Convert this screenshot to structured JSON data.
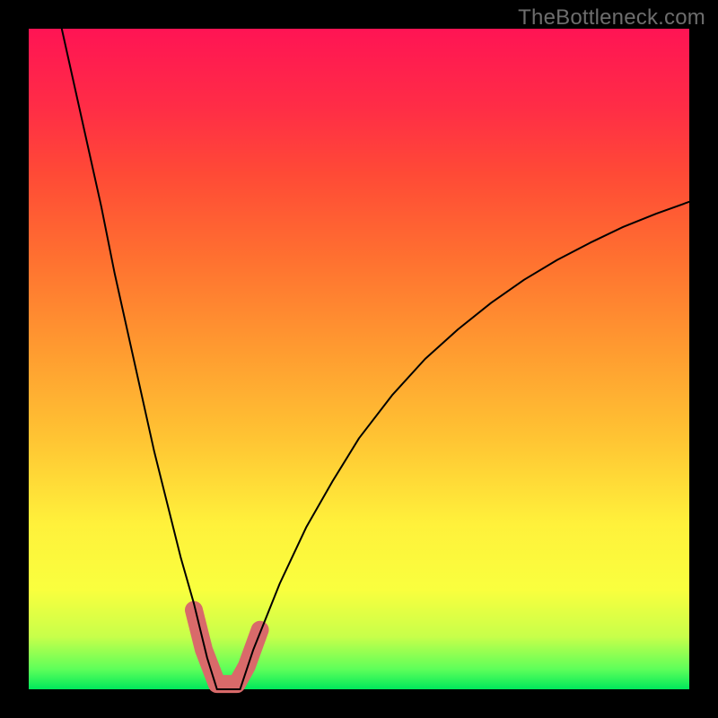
{
  "watermark": "TheBottleneck.com",
  "chart_data": {
    "type": "line",
    "title": "",
    "xlabel": "",
    "ylabel": "",
    "xlim": [
      0,
      100
    ],
    "ylim": [
      0,
      100
    ],
    "grid": false,
    "legend": false,
    "series": [
      {
        "name": "curve-left",
        "color": "#000000",
        "weight": 2,
        "x": [
          5.0,
          7.0,
          9.0,
          11.0,
          13.0,
          15.0,
          17.0,
          19.0,
          21.0,
          23.0,
          25.0,
          27.0,
          28.5
        ],
        "values": [
          100.0,
          91.0,
          82.0,
          73.0,
          63.0,
          54.0,
          45.0,
          36.0,
          28.0,
          20.0,
          13.0,
          4.8,
          0.0
        ]
      },
      {
        "name": "curve-right",
        "color": "#000000",
        "weight": 2,
        "x": [
          32.0,
          34.0,
          38.0,
          42.0,
          46.0,
          50.0,
          55.0,
          60.0,
          65.0,
          70.0,
          75.0,
          80.0,
          85.0,
          90.0,
          95.0,
          100.0
        ],
        "values": [
          0.0,
          6.0,
          16.0,
          24.5,
          31.5,
          38.0,
          44.5,
          50.0,
          54.5,
          58.5,
          62.0,
          65.0,
          67.6,
          70.0,
          72.0,
          73.8
        ]
      },
      {
        "name": "floor",
        "color": "#000000",
        "weight": 2,
        "x": [
          28.5,
          32.0
        ],
        "values": [
          0.0,
          0.0
        ]
      },
      {
        "name": "trough-highlight",
        "color": "#d96a6a",
        "weight": 20,
        "x": [
          25.0,
          26.5,
          28.5,
          30.0,
          31.5,
          33.0,
          35.0
        ],
        "values": [
          12.0,
          6.0,
          0.8,
          0.8,
          0.8,
          3.5,
          9.0
        ]
      }
    ]
  }
}
